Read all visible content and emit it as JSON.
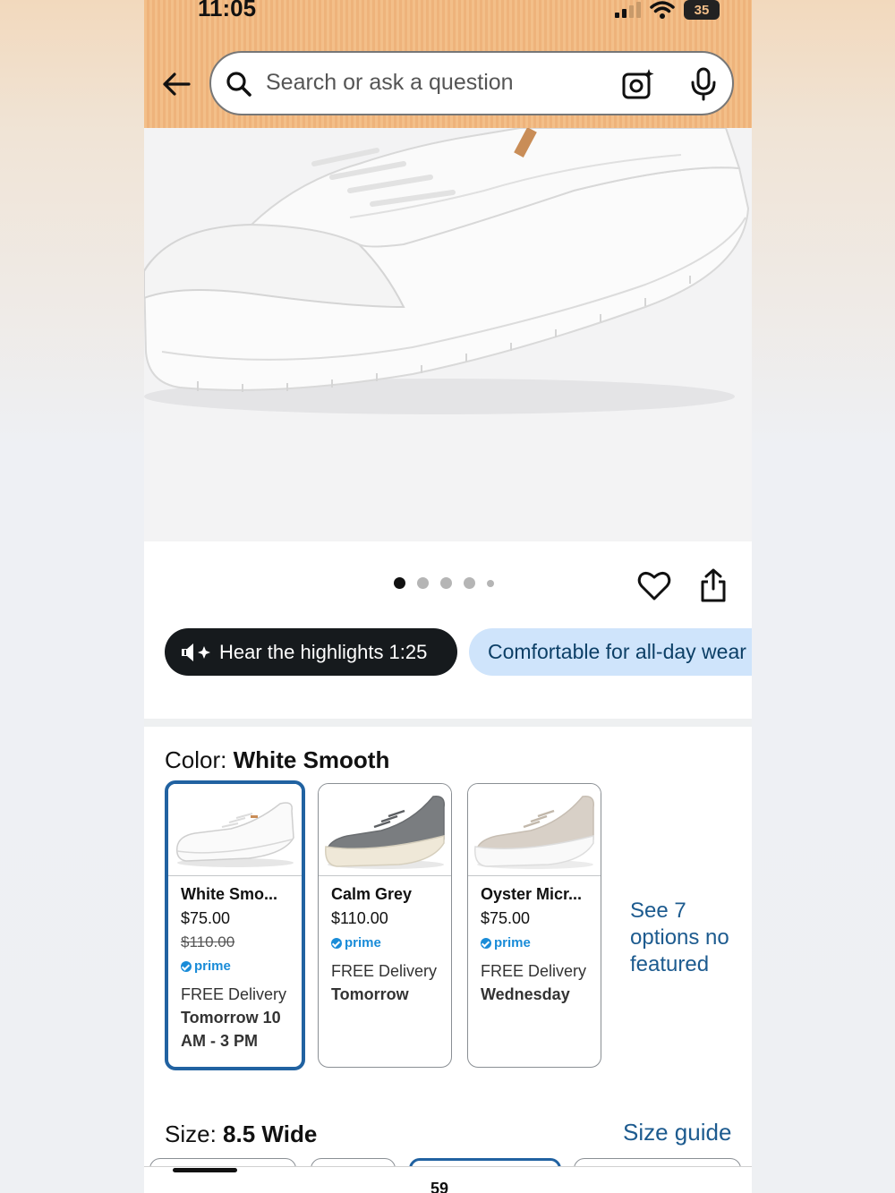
{
  "status_bar": {
    "time": "11:05",
    "battery": "35"
  },
  "search": {
    "placeholder": "Search or ask a question"
  },
  "gallery": {
    "dot_count": 5,
    "active_index": 0
  },
  "highlights": {
    "audio_label": "Hear the highlights 1:25",
    "chip_label": "Comfortable for all-day wear"
  },
  "color": {
    "label": "Color:",
    "selected": "White Smooth",
    "options": [
      {
        "name": "White Smo...",
        "price": "$75.00",
        "was_price": "$110.00",
        "prime": "prime",
        "delivery": "FREE Delivery",
        "delivery_day": "Tomorrow 10 AM - 3 PM"
      },
      {
        "name": "Calm Grey",
        "price": "$110.00",
        "prime": "prime",
        "delivery": "FREE Delivery",
        "delivery_day": "Tomorrow"
      },
      {
        "name": "Oyster Micr...",
        "price": "$75.00",
        "prime": "prime",
        "delivery": "FREE Delivery",
        "delivery_day": "Wednesday"
      }
    ],
    "see_more": "See 7 options no featured"
  },
  "size": {
    "label": "Size:",
    "selected": "8.5 Wide",
    "guide_link": "Size guide"
  },
  "bottom_nav": {
    "cart_count": "59"
  },
  "colors": {
    "accent_blue": "#2162a1",
    "link_blue": "#1d5b8f",
    "header_orange": "#f3bf89",
    "chip_blue": "#cfe4fb"
  }
}
